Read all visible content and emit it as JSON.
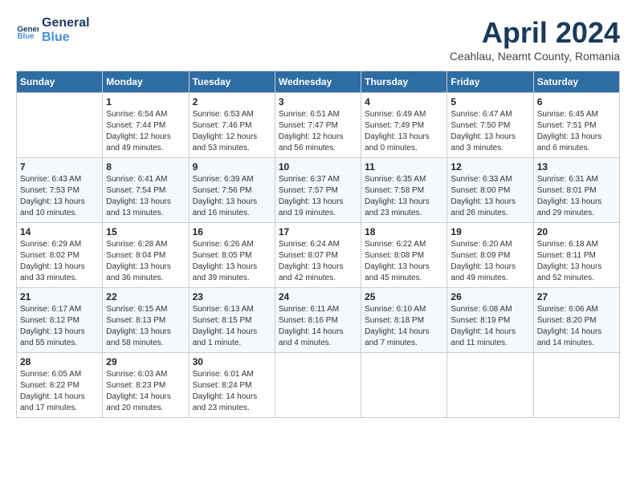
{
  "logo": {
    "line1": "General",
    "line2": "Blue"
  },
  "title": "April 2024",
  "subtitle": "Ceahlau, Neamt County, Romania",
  "weekdays": [
    "Sunday",
    "Monday",
    "Tuesday",
    "Wednesday",
    "Thursday",
    "Friday",
    "Saturday"
  ],
  "weeks": [
    [
      {
        "day": "",
        "info": ""
      },
      {
        "day": "1",
        "info": "Sunrise: 6:54 AM\nSunset: 7:44 PM\nDaylight: 12 hours\nand 49 minutes."
      },
      {
        "day": "2",
        "info": "Sunrise: 6:53 AM\nSunset: 7:46 PM\nDaylight: 12 hours\nand 53 minutes."
      },
      {
        "day": "3",
        "info": "Sunrise: 6:51 AM\nSunset: 7:47 PM\nDaylight: 12 hours\nand 56 minutes."
      },
      {
        "day": "4",
        "info": "Sunrise: 6:49 AM\nSunset: 7:49 PM\nDaylight: 13 hours\nand 0 minutes."
      },
      {
        "day": "5",
        "info": "Sunrise: 6:47 AM\nSunset: 7:50 PM\nDaylight: 13 hours\nand 3 minutes."
      },
      {
        "day": "6",
        "info": "Sunrise: 6:45 AM\nSunset: 7:51 PM\nDaylight: 13 hours\nand 6 minutes."
      }
    ],
    [
      {
        "day": "7",
        "info": "Sunrise: 6:43 AM\nSunset: 7:53 PM\nDaylight: 13 hours\nand 10 minutes."
      },
      {
        "day": "8",
        "info": "Sunrise: 6:41 AM\nSunset: 7:54 PM\nDaylight: 13 hours\nand 13 minutes."
      },
      {
        "day": "9",
        "info": "Sunrise: 6:39 AM\nSunset: 7:56 PM\nDaylight: 13 hours\nand 16 minutes."
      },
      {
        "day": "10",
        "info": "Sunrise: 6:37 AM\nSunset: 7:57 PM\nDaylight: 13 hours\nand 19 minutes."
      },
      {
        "day": "11",
        "info": "Sunrise: 6:35 AM\nSunset: 7:58 PM\nDaylight: 13 hours\nand 23 minutes."
      },
      {
        "day": "12",
        "info": "Sunrise: 6:33 AM\nSunset: 8:00 PM\nDaylight: 13 hours\nand 26 minutes."
      },
      {
        "day": "13",
        "info": "Sunrise: 6:31 AM\nSunset: 8:01 PM\nDaylight: 13 hours\nand 29 minutes."
      }
    ],
    [
      {
        "day": "14",
        "info": "Sunrise: 6:29 AM\nSunset: 8:02 PM\nDaylight: 13 hours\nand 33 minutes."
      },
      {
        "day": "15",
        "info": "Sunrise: 6:28 AM\nSunset: 8:04 PM\nDaylight: 13 hours\nand 36 minutes."
      },
      {
        "day": "16",
        "info": "Sunrise: 6:26 AM\nSunset: 8:05 PM\nDaylight: 13 hours\nand 39 minutes."
      },
      {
        "day": "17",
        "info": "Sunrise: 6:24 AM\nSunset: 8:07 PM\nDaylight: 13 hours\nand 42 minutes."
      },
      {
        "day": "18",
        "info": "Sunrise: 6:22 AM\nSunset: 8:08 PM\nDaylight: 13 hours\nand 45 minutes."
      },
      {
        "day": "19",
        "info": "Sunrise: 6:20 AM\nSunset: 8:09 PM\nDaylight: 13 hours\nand 49 minutes."
      },
      {
        "day": "20",
        "info": "Sunrise: 6:18 AM\nSunset: 8:11 PM\nDaylight: 13 hours\nand 52 minutes."
      }
    ],
    [
      {
        "day": "21",
        "info": "Sunrise: 6:17 AM\nSunset: 8:12 PM\nDaylight: 13 hours\nand 55 minutes."
      },
      {
        "day": "22",
        "info": "Sunrise: 6:15 AM\nSunset: 8:13 PM\nDaylight: 13 hours\nand 58 minutes."
      },
      {
        "day": "23",
        "info": "Sunrise: 6:13 AM\nSunset: 8:15 PM\nDaylight: 14 hours\nand 1 minute."
      },
      {
        "day": "24",
        "info": "Sunrise: 6:11 AM\nSunset: 8:16 PM\nDaylight: 14 hours\nand 4 minutes."
      },
      {
        "day": "25",
        "info": "Sunrise: 6:10 AM\nSunset: 8:18 PM\nDaylight: 14 hours\nand 7 minutes."
      },
      {
        "day": "26",
        "info": "Sunrise: 6:08 AM\nSunset: 8:19 PM\nDaylight: 14 hours\nand 11 minutes."
      },
      {
        "day": "27",
        "info": "Sunrise: 6:06 AM\nSunset: 8:20 PM\nDaylight: 14 hours\nand 14 minutes."
      }
    ],
    [
      {
        "day": "28",
        "info": "Sunrise: 6:05 AM\nSunset: 8:22 PM\nDaylight: 14 hours\nand 17 minutes."
      },
      {
        "day": "29",
        "info": "Sunrise: 6:03 AM\nSunset: 8:23 PM\nDaylight: 14 hours\nand 20 minutes."
      },
      {
        "day": "30",
        "info": "Sunrise: 6:01 AM\nSunset: 8:24 PM\nDaylight: 14 hours\nand 23 minutes."
      },
      {
        "day": "",
        "info": ""
      },
      {
        "day": "",
        "info": ""
      },
      {
        "day": "",
        "info": ""
      },
      {
        "day": "",
        "info": ""
      }
    ]
  ]
}
